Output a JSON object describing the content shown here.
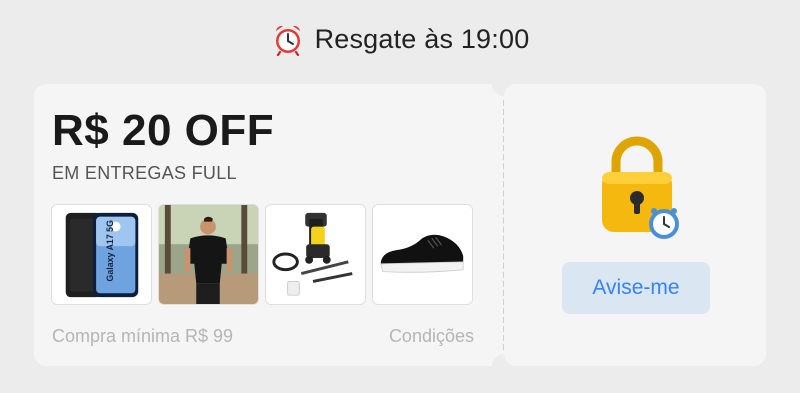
{
  "header": {
    "title": "Resgate às 19:00",
    "icon": "alarm-clock-icon"
  },
  "coupon": {
    "amount": "R$ 20 OFF",
    "subtitle": "EM ENTREGAS FULL",
    "products": [
      {
        "name": "Galaxy A17 5G",
        "icon": "smartphone-image"
      },
      {
        "name": "camiseta",
        "icon": "person-tshirt-image"
      },
      {
        "name": "lavadora de alta pressão",
        "icon": "pressure-washer-image"
      },
      {
        "name": "tênis",
        "icon": "sneaker-image"
      }
    ],
    "min_purchase": "Compra mínima R$ 99",
    "conditions": "Condições"
  },
  "action": {
    "button_label": "Avise-me",
    "icon": "lock-clock-icon"
  },
  "colors": {
    "accent": "#3483fa",
    "button_bg": "#dbe6f3",
    "lock": "#f5b80e"
  }
}
